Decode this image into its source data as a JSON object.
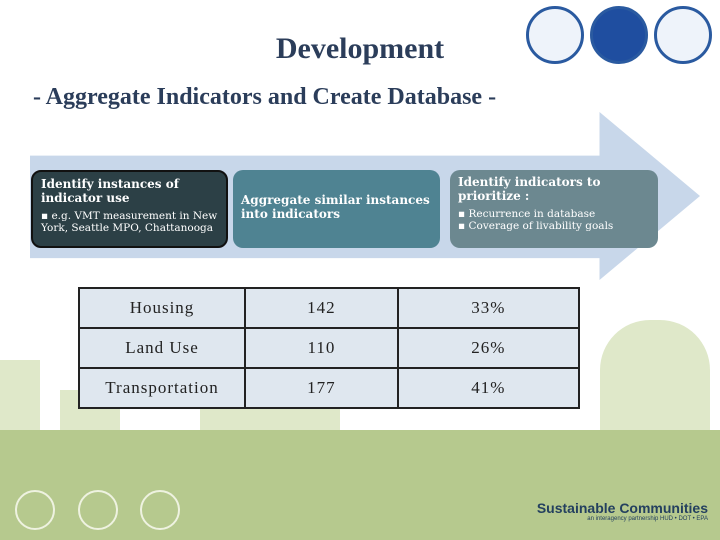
{
  "title": "Development",
  "subtitle": "- Aggregate Indicators and Create Database -",
  "steps": [
    {
      "heading": "Identify instances of indicator use",
      "bullets": [
        "e.g. VMT measurement in New York, Seattle MPO, Chattanooga"
      ]
    },
    {
      "heading": "Aggregate similar instances into indicators",
      "bullets": []
    },
    {
      "heading": "Identify indicators to prioritize :",
      "bullets": [
        "Recurrence in database",
        "Coverage of livability goals"
      ]
    }
  ],
  "table": [
    {
      "category": "Housing",
      "count": "142",
      "percent": "33%"
    },
    {
      "category": "Land Use",
      "count": "110",
      "percent": "26%"
    },
    {
      "category": "Transportation",
      "count": "177",
      "percent": "41%"
    }
  ],
  "footer": {
    "brand": "Sustainable Communities",
    "tagline": "an interagency partnership HUD • DOT • EPA"
  }
}
